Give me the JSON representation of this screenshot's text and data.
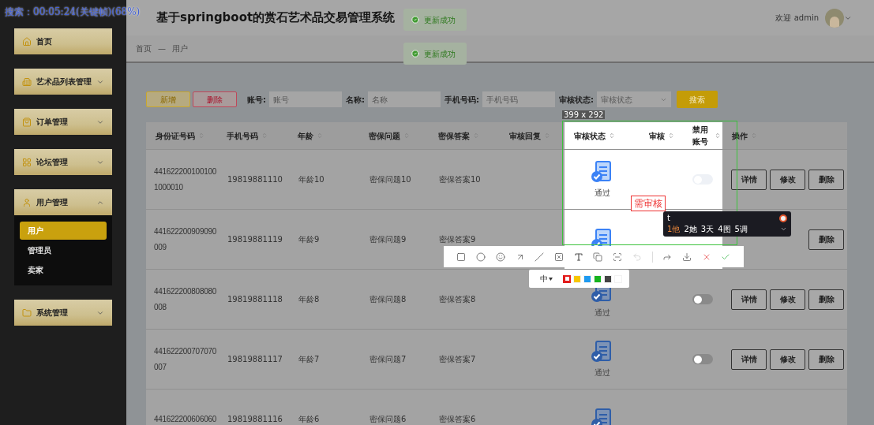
{
  "video_caption": "搜索：00:05:24(关键帧)(68%)",
  "sidebar": {
    "items": [
      {
        "label": "首页"
      },
      {
        "label": "艺术品列表管理",
        "expanded": false
      },
      {
        "label": "订单管理",
        "expanded": false
      },
      {
        "label": "论坛管理",
        "expanded": false
      },
      {
        "label": "用户管理",
        "expanded": true,
        "children": [
          {
            "label": "用户",
            "selected": true
          },
          {
            "label": "管理员",
            "selected": false
          },
          {
            "label": "卖家",
            "selected": false
          }
        ]
      },
      {
        "label": "系统管理",
        "expanded": false
      }
    ]
  },
  "header": {
    "title": "基于springboot的赏石艺术品交易管理系统",
    "welcome": "欢迎 admin"
  },
  "toasts": [
    "更新成功",
    "更新成功"
  ],
  "breadcrumb": {
    "items": [
      "首页",
      "用户"
    ],
    "separator": "—"
  },
  "search_bar": {
    "buttons": [
      {
        "label": "新增",
        "kind": "add"
      },
      {
        "label": "删除",
        "kind": "delete"
      }
    ],
    "filters": [
      {
        "label": "账号:",
        "placeholder": "账号",
        "kind": "input"
      },
      {
        "label": "名称:",
        "placeholder": "名称",
        "kind": "input"
      },
      {
        "label": "手机号码:",
        "placeholder": "手机号码",
        "kind": "input"
      },
      {
        "label": "审核状态:",
        "placeholder": "审核状态",
        "kind": "select"
      }
    ],
    "search_button": "搜索"
  },
  "table": {
    "columns": [
      "身份证号码",
      "手机号码",
      "年龄",
      "密保问题",
      "密保答案",
      "审核回复",
      "审核状态",
      "审核",
      "禁用账号",
      "操作"
    ],
    "rows": [
      {
        "id": "441622200100100 1000010",
        "phone": "19819881110",
        "age": "年龄10",
        "question": "密保问题10",
        "answer": "密保答案10",
        "status": "通过",
        "disabled_account": false,
        "actions": [
          "详情",
          "修改",
          "删除"
        ]
      },
      {
        "id": "441622200909090 009",
        "phone": "19819881119",
        "age": "年龄9",
        "question": "密保问题9",
        "answer": "密保答案9",
        "actions": [
          "删除"
        ]
      },
      {
        "id": "441622200808080 008",
        "phone": "19819881118",
        "age": "年龄8",
        "question": "密保问题8",
        "answer": "密保答案8",
        "status": "通过",
        "disabled_account": false,
        "actions": [
          "详情",
          "修改",
          "删除"
        ]
      },
      {
        "id": "441622200707070 007",
        "phone": "19819881117",
        "age": "年龄7",
        "question": "密保问题7",
        "answer": "密保答案7",
        "status": "通过",
        "disabled_account": false,
        "actions": [
          "详情",
          "修改",
          "删除"
        ]
      },
      {
        "id": "441622200606060",
        "phone": "19819881116",
        "age": "年龄6",
        "question": "密保问题6",
        "answer": "密保答案6"
      }
    ]
  },
  "capture": {
    "size_label": "399 x 292",
    "annotation": "需审核",
    "tools": [
      {
        "kind": "rect",
        "selected": false
      },
      {
        "kind": "circle",
        "selected": false
      },
      {
        "kind": "emoji",
        "selected": false
      },
      {
        "kind": "arrow",
        "selected": false
      },
      {
        "kind": "line",
        "selected": false
      },
      {
        "kind": "mosaic",
        "selected": false
      },
      {
        "kind": "text",
        "selected": true
      },
      {
        "kind": "copy",
        "selected": false
      },
      {
        "kind": "scan",
        "selected": false
      },
      {
        "kind": "undo",
        "selected": false,
        "disabled": true
      },
      {
        "kind": "divider"
      },
      {
        "kind": "share",
        "selected": false
      },
      {
        "kind": "save",
        "selected": false
      },
      {
        "kind": "cancel",
        "selected": false
      },
      {
        "kind": "done",
        "selected": false
      }
    ],
    "pen_size": "中",
    "colors": [
      {
        "color": "#e21c1c",
        "selected": true
      },
      {
        "color": "#f7c600",
        "selected": false
      },
      {
        "color": "#1e9af0",
        "selected": false
      },
      {
        "color": "#16b31e",
        "selected": false
      },
      {
        "color": "#444444",
        "selected": false
      },
      {
        "color": "#ffffff",
        "selected": false
      }
    ]
  },
  "ime": {
    "input": "t",
    "candidates": [
      {
        "number": "1",
        "char": "他",
        "selected": true
      },
      {
        "number": "2",
        "char": "她",
        "selected": false
      },
      {
        "number": "3",
        "char": "天",
        "selected": false
      },
      {
        "number": "4",
        "char": "图",
        "selected": false
      },
      {
        "number": "5",
        "char": "调",
        "selected": false
      }
    ]
  }
}
